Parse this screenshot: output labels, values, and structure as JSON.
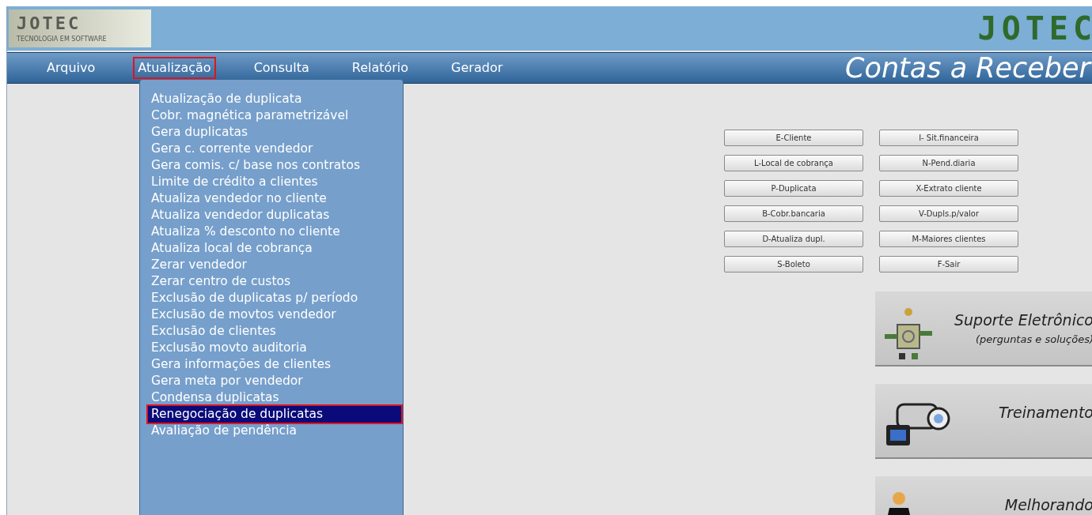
{
  "logo": {
    "name": "JOTEC",
    "tagline": "TECNOLOGIA EM SOFTWARE"
  },
  "brand": "JOTEC",
  "menu_bar": [
    {
      "label": "Arquivo",
      "selected": false
    },
    {
      "label": "Atualização",
      "selected": true
    },
    {
      "label": "Consulta",
      "selected": false
    },
    {
      "label": "Relatório",
      "selected": false
    },
    {
      "label": "Gerador",
      "selected": false
    }
  ],
  "module_title": "Contas a Receber",
  "dropdown": [
    {
      "label": "Atualização de duplicata",
      "selected": false
    },
    {
      "label": "Cobr. magnética parametrizável",
      "selected": false
    },
    {
      "label": "Gera duplicatas",
      "selected": false
    },
    {
      "label": "Gera c. corrente vendedor",
      "selected": false
    },
    {
      "label": "Gera comis. c/ base nos contratos",
      "selected": false
    },
    {
      "label": "Limite de crédito a clientes",
      "selected": false
    },
    {
      "label": "Atualiza vendedor no cliente",
      "selected": false
    },
    {
      "label": "Atualiza vendedor duplicatas",
      "selected": false
    },
    {
      "label": "Atualiza % desconto no cliente",
      "selected": false
    },
    {
      "label": "Atualiza local de cobrança",
      "selected": false
    },
    {
      "label": "Zerar vendedor",
      "selected": false
    },
    {
      "label": "Zerar centro de custos",
      "selected": false
    },
    {
      "label": "Exclusão de duplicatas p/ período",
      "selected": false
    },
    {
      "label": "Exclusão de movtos vendedor",
      "selected": false
    },
    {
      "label": "Exclusão de clientes",
      "selected": false
    },
    {
      "label": "Exclusão movto auditoria",
      "selected": false
    },
    {
      "label": "Gera informações de clientes",
      "selected": false
    },
    {
      "label": "Gera meta por vendedor",
      "selected": false
    },
    {
      "label": "Condensa duplicatas",
      "selected": false
    },
    {
      "label": "Renegociação de duplicatas",
      "selected": true
    },
    {
      "label": "Avaliação de pendência",
      "selected": false
    }
  ],
  "shortcut_buttons": [
    "E-Cliente",
    "I- Sit.financeira",
    "L-Local de cobrança",
    "N-Pend.diaria",
    "P-Duplicata",
    "X-Extrato cliente",
    "B-Cobr.bancaria",
    "V-Dupls.p/valor",
    "D-Atualiza dupl.",
    "M-Maiores clientes",
    "S-Boleto",
    "F-Sair"
  ],
  "big_buttons": [
    {
      "kind": "support",
      "label": "Suporte Eletrônico",
      "sublabel": "(perguntas e soluções)"
    },
    {
      "kind": "training",
      "label": "Treinamento"
    },
    {
      "kind": "improving",
      "label": "Melhorando"
    }
  ]
}
